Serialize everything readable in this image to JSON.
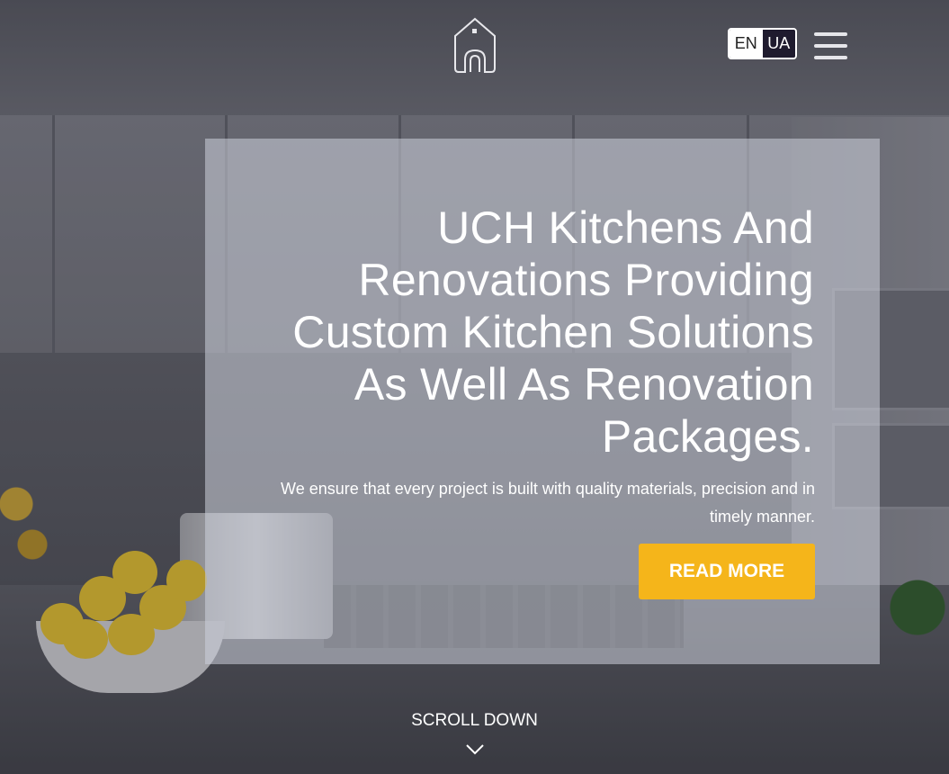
{
  "header": {
    "logo_icon": "house-logo-icon",
    "languages": [
      "EN",
      "UA"
    ],
    "active_language": "EN",
    "menu_icon": "hamburger-menu-icon"
  },
  "hero": {
    "headline": "UCH Kitchens And Renovations Providing Custom Kitchen Solutions As Well As Renovation Packages.",
    "subtext": "We ensure that every project is built with quality materials, precision and in timely manner.",
    "cta_label": "READ MORE"
  },
  "footer": {
    "scroll_label": "SCROLL DOWN",
    "scroll_icon": "chevron-down-icon"
  },
  "colors": {
    "accent": "#f5b51a",
    "text": "#ffffff",
    "lang_active_bg": "#ffffff",
    "lang_inactive_bg": "#1f1b2e"
  }
}
